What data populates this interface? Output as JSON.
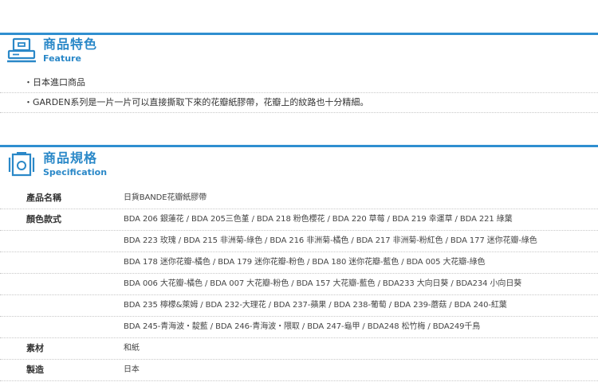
{
  "feature": {
    "title": "商品特色",
    "subtitle": "Feature",
    "items": [
      "・日本進口商品",
      "・GARDEN系列是一片一片可以直接撕取下來的花瓣紙膠帶，花瓣上的紋路也十分精細。"
    ]
  },
  "specification": {
    "title": "商品規格",
    "subtitle": "Specification",
    "rows": [
      {
        "label": "產品名稱",
        "value": "日貨BANDE花瓣紙膠帶"
      },
      {
        "label": "顏色款式",
        "value": "BDA 206 銀蓮花 / BDA 205三色堇 / BDA 218 粉色櫻花 / BDA 220 草莓 / BDA 219 幸運草 / BDA 221 綠葉"
      },
      {
        "label": "",
        "value": "BDA 223 玫瑰 / BDA 215 非洲菊-綠色 / BDA 216 非洲菊-橘色 / BDA 217 非洲菊-粉紅色 / BDA 177 迷你花瓣-綠色"
      },
      {
        "label": "",
        "value": "BDA 178 迷你花瓣-橘色 / BDA 179 迷你花瓣-粉色 / BDA 180 迷你花瓣-藍色 / BDA 005 大花瓣-綠色"
      },
      {
        "label": "",
        "value": "BDA 006 大花瓣-橘色 / BDA 007 大花瓣-粉色 / BDA 157 大花瓣-藍色 / BDA233 大向日葵 / BDA234 小向日葵"
      },
      {
        "label": "",
        "value": "BDA 235 檸檬&萊姆 / BDA 232-大理花 / BDA 237-蘋果 / BDA 238-葡萄 / BDA 239-蘑菇 / BDA 240-紅葉"
      },
      {
        "label": "",
        "value": "BDA 245-青海波・靛藍 / BDA 246-青海波・隈取 / BDA 247-龜甲 / BDA248 松竹梅 / BDA249千鳥"
      },
      {
        "label": "素材",
        "value": "和紙"
      },
      {
        "label": "製造",
        "value": "日本"
      }
    ]
  },
  "colors": {
    "accent": "#2f8fd0",
    "accent_text": "#2a88c8"
  },
  "icons": {
    "feature": "register-icon",
    "specification": "camera-icon"
  }
}
